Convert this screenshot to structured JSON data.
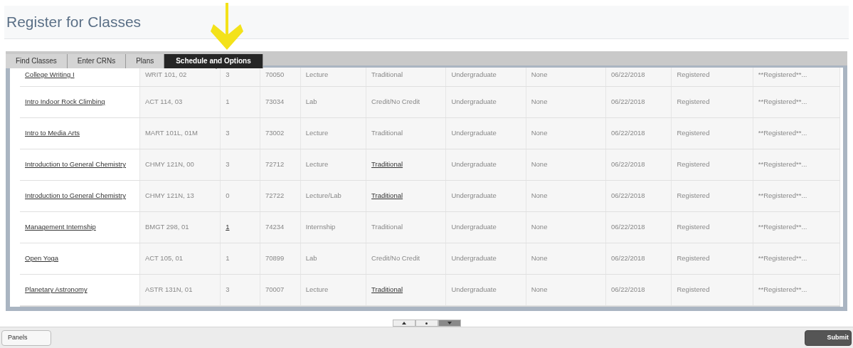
{
  "page": {
    "title": "Register for Classes"
  },
  "tabs": [
    {
      "label": "Find Classes",
      "selected": false
    },
    {
      "label": "Enter CRNs",
      "selected": false
    },
    {
      "label": "Plans",
      "selected": false
    },
    {
      "label": "Schedule and Options",
      "selected": true
    }
  ],
  "table": {
    "rows": [
      {
        "cells": [
          {
            "text": "College Writing I",
            "link": true
          },
          {
            "text": "WRIT 101, 02",
            "link": false
          },
          {
            "text": "3",
            "link": false
          },
          {
            "text": "70050",
            "link": false
          },
          {
            "text": "Lecture",
            "link": false
          },
          {
            "text": "Traditional",
            "link": false
          },
          {
            "text": "Undergraduate",
            "link": false
          },
          {
            "text": "None",
            "link": false
          },
          {
            "text": "06/22/2018",
            "link": false
          },
          {
            "text": "Registered",
            "link": false
          },
          {
            "text": "**Registered**...",
            "link": false
          }
        ]
      },
      {
        "cells": [
          {
            "text": "Intro Indoor Rock Climbing",
            "link": true
          },
          {
            "text": "ACT 114, 03",
            "link": false
          },
          {
            "text": "1",
            "link": false
          },
          {
            "text": "73034",
            "link": false
          },
          {
            "text": "Lab",
            "link": false
          },
          {
            "text": "Credit/No Credit",
            "link": false
          },
          {
            "text": "Undergraduate",
            "link": false
          },
          {
            "text": "None",
            "link": false
          },
          {
            "text": "06/22/2018",
            "link": false
          },
          {
            "text": "Registered",
            "link": false
          },
          {
            "text": "**Registered**...",
            "link": false
          }
        ]
      },
      {
        "cells": [
          {
            "text": "Intro to Media Arts",
            "link": true
          },
          {
            "text": "MART 101L, 01M",
            "link": false
          },
          {
            "text": "3",
            "link": false
          },
          {
            "text": "73002",
            "link": false
          },
          {
            "text": "Lecture",
            "link": false
          },
          {
            "text": "Traditional",
            "link": false
          },
          {
            "text": "Undergraduate",
            "link": false
          },
          {
            "text": "None",
            "link": false
          },
          {
            "text": "06/22/2018",
            "link": false
          },
          {
            "text": "Registered",
            "link": false
          },
          {
            "text": "**Registered**...",
            "link": false
          }
        ]
      },
      {
        "cells": [
          {
            "text": "Introduction to General Chemistry",
            "link": true
          },
          {
            "text": "CHMY 121N, 00",
            "link": false
          },
          {
            "text": "3",
            "link": false
          },
          {
            "text": "72712",
            "link": false
          },
          {
            "text": "Lecture",
            "link": false
          },
          {
            "text": "Traditional",
            "link": true
          },
          {
            "text": "Undergraduate",
            "link": false
          },
          {
            "text": "None",
            "link": false
          },
          {
            "text": "06/22/2018",
            "link": false
          },
          {
            "text": "Registered",
            "link": false
          },
          {
            "text": "**Registered**...",
            "link": false
          }
        ]
      },
      {
        "cells": [
          {
            "text": "Introduction to General Chemistry",
            "link": true
          },
          {
            "text": "CHMY 121N, 13",
            "link": false
          },
          {
            "text": "0",
            "link": false
          },
          {
            "text": "72722",
            "link": false
          },
          {
            "text": "Lecture/Lab",
            "link": false
          },
          {
            "text": "Traditional",
            "link": true
          },
          {
            "text": "Undergraduate",
            "link": false
          },
          {
            "text": "None",
            "link": false
          },
          {
            "text": "06/22/2018",
            "link": false
          },
          {
            "text": "Registered",
            "link": false
          },
          {
            "text": "**Registered**...",
            "link": false
          }
        ]
      },
      {
        "cells": [
          {
            "text": "Management Internship",
            "link": true
          },
          {
            "text": "BMGT 298, 01",
            "link": false
          },
          {
            "text": "1",
            "link": true
          },
          {
            "text": "74234",
            "link": false
          },
          {
            "text": "Internship",
            "link": false
          },
          {
            "text": "Traditional",
            "link": false
          },
          {
            "text": "Undergraduate",
            "link": false
          },
          {
            "text": "None",
            "link": false
          },
          {
            "text": "06/22/2018",
            "link": false
          },
          {
            "text": "Registered",
            "link": false
          },
          {
            "text": "**Registered**...",
            "link": false
          }
        ]
      },
      {
        "cells": [
          {
            "text": "Open Yoga",
            "link": true
          },
          {
            "text": "ACT 105, 01",
            "link": false
          },
          {
            "text": "1",
            "link": false
          },
          {
            "text": "70899",
            "link": false
          },
          {
            "text": "Lab",
            "link": false
          },
          {
            "text": "Credit/No Credit",
            "link": false
          },
          {
            "text": "Undergraduate",
            "link": false
          },
          {
            "text": "None",
            "link": false
          },
          {
            "text": "06/22/2018",
            "link": false
          },
          {
            "text": "Registered",
            "link": false
          },
          {
            "text": "**Registered**...",
            "link": false
          }
        ]
      },
      {
        "cells": [
          {
            "text": "Planetary Astronomy",
            "link": true
          },
          {
            "text": "ASTR 131N, 01",
            "link": false
          },
          {
            "text": "3",
            "link": false
          },
          {
            "text": "70007",
            "link": false
          },
          {
            "text": "Lecture",
            "link": false
          },
          {
            "text": "Traditional",
            "link": true
          },
          {
            "text": "Undergraduate",
            "link": false
          },
          {
            "text": "None",
            "link": false
          },
          {
            "text": "06/22/2018",
            "link": false
          },
          {
            "text": "Registered",
            "link": false
          },
          {
            "text": "**Registered**...",
            "link": false
          }
        ]
      }
    ]
  },
  "pager": [
    {
      "kind": "up",
      "selected": false
    },
    {
      "kind": "dot",
      "selected": false
    },
    {
      "kind": "down",
      "selected": true
    }
  ],
  "footer": {
    "panels_button": "Panels",
    "submit_button": "Submit"
  }
}
